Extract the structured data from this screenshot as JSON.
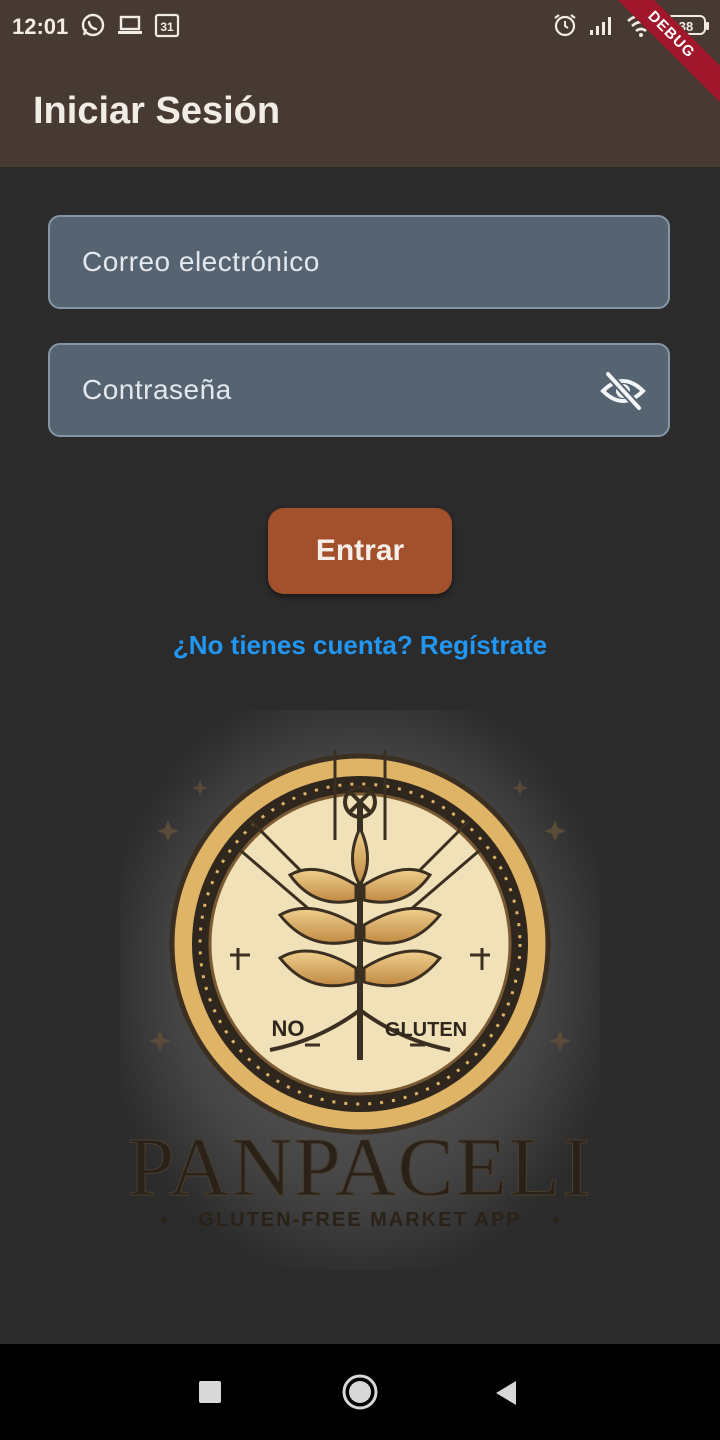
{
  "status_bar": {
    "time": "12:01",
    "left_icons": [
      "whatsapp-icon",
      "laptop-icon",
      "calendar-icon"
    ],
    "calendar_day": "31",
    "right_icons": [
      "alarm-icon",
      "signal-icon",
      "wifi-icon",
      "battery-icon"
    ],
    "battery_level": "38"
  },
  "debug_banner": "DEBUG",
  "app_bar": {
    "title": "Iniciar Sesión",
    "background": "#473a32"
  },
  "form": {
    "email_placeholder": "Correo electrónico",
    "email_value": "",
    "password_placeholder": "Contraseña",
    "password_value": "",
    "password_visibility_icon": "visibility-off-icon",
    "submit_label": "Entrar",
    "register_link": "¿No tienes cuenta? Regístrate"
  },
  "logo": {
    "badge_left": "NO",
    "badge_right": "GLUTEN",
    "brand": "PANPACELI",
    "tagline": "GLUTEN-FREE MARKET APP"
  },
  "nav_bar": {
    "buttons": [
      "recents-square-icon",
      "home-circle-icon",
      "back-triangle-icon"
    ]
  },
  "colors": {
    "accent_button": "#a3502c",
    "link": "#2196f3",
    "field_bg": "#566370",
    "page_bg": "#2b2b2b"
  }
}
